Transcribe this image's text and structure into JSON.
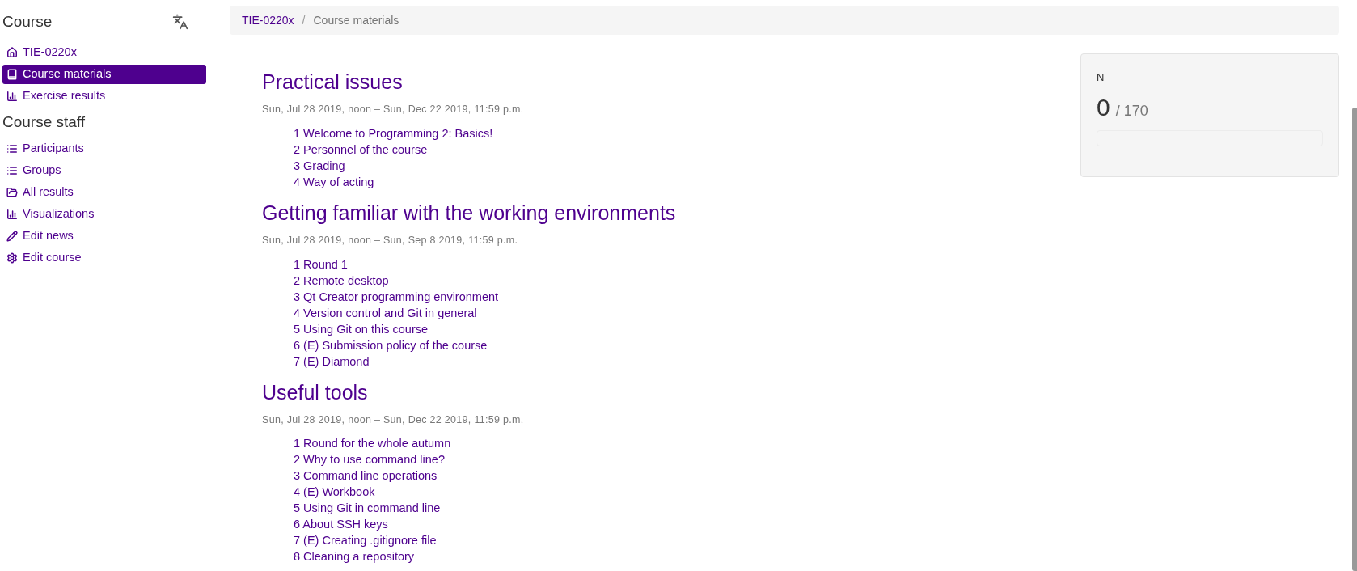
{
  "sidebar": {
    "title": "Course",
    "course_items": [
      {
        "label": "TIE-0220x",
        "selected": false
      },
      {
        "label": "Course materials",
        "selected": true
      },
      {
        "label": "Exercise results",
        "selected": false
      }
    ],
    "staff_title": "Course staff",
    "staff_items": [
      {
        "label": "Participants",
        "selected": false
      },
      {
        "label": "Groups",
        "selected": false
      },
      {
        "label": "All results",
        "selected": false
      },
      {
        "label": "Visualizations",
        "selected": false
      },
      {
        "label": "Edit news",
        "selected": false
      },
      {
        "label": "Edit course",
        "selected": false
      }
    ]
  },
  "breadcrumb": [
    "TIE-0220x",
    "Course materials"
  ],
  "breadcrumb_separator": "/",
  "modules": [
    {
      "title": "Practical issues",
      "dates": "Sun, Jul 28 2019, noon – Sun, Dec 22 2019, 11:59 p.m.",
      "chapters": [
        "1 Welcome to Programming 2: Basics!",
        "2 Personnel of the course",
        "3 Grading",
        "4 Way of acting"
      ]
    },
    {
      "title": "Getting familiar with the working environments",
      "dates": "Sun, Jul 28 2019, noon – Sun, Sep 8 2019, 11:59 p.m.",
      "chapters": [
        "1 Round 1",
        "2 Remote desktop",
        "3 Qt Creator programming environment",
        "4 Version control and Git in general",
        "5 Using Git on this course",
        "6 (E) Submission policy of the course",
        "7 (E) Diamond"
      ]
    },
    {
      "title": "Useful tools",
      "dates": "Sun, Jul 28 2019, noon – Sun, Dec 22 2019, 11:59 p.m.",
      "chapters": [
        "1 Round for the whole autumn",
        "2 Why to use command line?",
        "3 Command line operations",
        "4 (E) Workbook",
        "5 Using Git in command line",
        "6 About SSH keys",
        "7 (E) Creating .gitignore file",
        "8 Cleaning a repository"
      ]
    }
  ],
  "points": {
    "label": "N",
    "value": "0",
    "total": "/ 170",
    "level": 0
  }
}
